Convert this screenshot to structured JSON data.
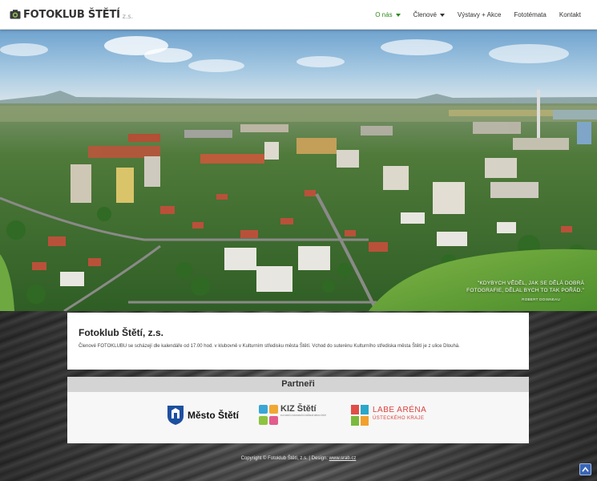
{
  "logo": {
    "main": "FOTOKLUB ŠTĚTÍ",
    "sub": "z.s."
  },
  "nav": {
    "items": [
      {
        "label": "O nás",
        "active": true,
        "dropdown": true
      },
      {
        "label": "Členové",
        "active": false,
        "dropdown": true
      },
      {
        "label": "Výstavy + Akce",
        "active": false,
        "dropdown": false
      },
      {
        "label": "Fototémata",
        "active": false,
        "dropdown": false
      },
      {
        "label": "Kontakt",
        "active": false,
        "dropdown": false
      }
    ]
  },
  "hero": {
    "quote": "\"KDYBYCH VĚDĚL, JAK SE DĚLÁ DOBRÁ FOTOGRAFIE, DĚLAL BYCH TO TAK POŘÁD.\"",
    "author": "ROBERT DOISNEAU"
  },
  "content": {
    "title": "Fotoklub Štětí, z.s.",
    "text": "Členové FOTOKLUBU se scházejí dle kalendáře od 17.00 hod. v klubovně v Kulturním středisku města Štětí. Vchod do suterénu Kulturního střediska města Štětí je z ulice Dlouhá."
  },
  "partners": {
    "heading": "Partneři",
    "mesto": "Město Štětí",
    "kiz": {
      "title": "KIZ Štětí",
      "sub": "KULTURNÍ A INFORMAČNÍ ZAŘÍZENÍ MĚSTA ŠTĚTÍ"
    },
    "labe": {
      "title": "LABE ARÉNA",
      "sub": "ÚSTECKÉHO KRAJE"
    }
  },
  "footer": {
    "copyright": "Copyright © Fotoklub Štětí, z.s. | Design:",
    "design_link": "www.srab.cz"
  },
  "colors": {
    "nav_active": "#2e8b1e",
    "labe_red": "#d9443f",
    "back_to_top": "#3a66b8"
  },
  "icons": {
    "logo": "camera-icon",
    "back_to_top": "arrow-up-icon"
  }
}
